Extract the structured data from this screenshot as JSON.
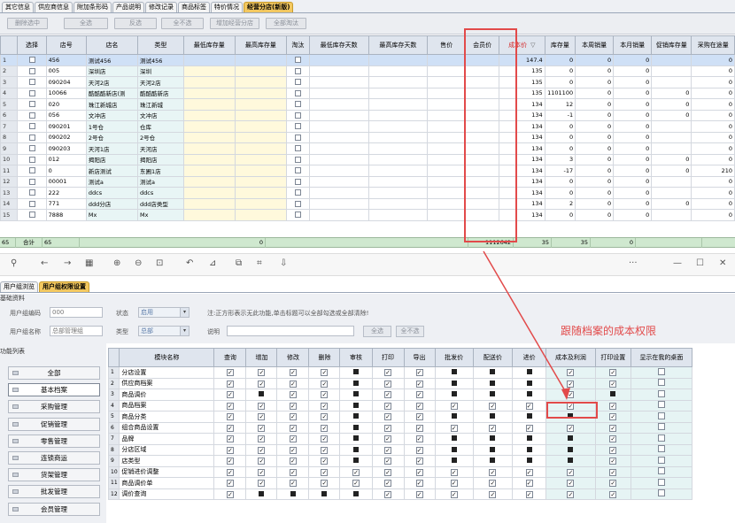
{
  "top_tabs": [
    "其它信息",
    "供应商信息",
    "附加条形码",
    "产品说明",
    "修改记录",
    "商品标签",
    "特价情况",
    "经营分店(新版)"
  ],
  "top_active_tab": 7,
  "toolbar1": [
    "删除选中",
    "全选",
    "反选",
    "全不选",
    "增加经营分店",
    "全部淘汰"
  ],
  "grid1": {
    "headers": [
      "",
      "选择",
      "店号",
      "店名",
      "类型",
      "最低库存量",
      "最高库存量",
      "淘汰",
      "最低库存天数",
      "最高库存天数",
      "售价",
      "会员价",
      "成本价",
      "库存量",
      "本周销量",
      "本月销量",
      "促销库存量",
      "采购在途量"
    ],
    "sort_icon": "▽",
    "rows": [
      [
        "1",
        "",
        "456",
        "测试456",
        "测试456",
        "",
        "",
        "",
        "",
        "",
        "",
        "",
        "147.4",
        "0",
        "0",
        "0",
        "",
        "0"
      ],
      [
        "2",
        "",
        "005",
        "深圳店",
        "深圳",
        "",
        "",
        "",
        "",
        "",
        "",
        "",
        "135",
        "0",
        "0",
        "0",
        "",
        "0"
      ],
      [
        "3",
        "",
        "090204",
        "天河2店",
        "天河2店",
        "",
        "",
        "",
        "",
        "",
        "",
        "",
        "135",
        "0",
        "0",
        "0",
        "",
        "0"
      ],
      [
        "4",
        "",
        "10066",
        "酷酷酷新店(测",
        "酷酷酷新店",
        "",
        "",
        "",
        "",
        "",
        "",
        "",
        "135",
        "1101100",
        "0",
        "0",
        "0",
        "0"
      ],
      [
        "5",
        "",
        "020",
        "珠江新城店",
        "珠江新城",
        "",
        "",
        "",
        "",
        "",
        "",
        "",
        "134",
        "12",
        "0",
        "0",
        "0",
        "0"
      ],
      [
        "6",
        "",
        "056",
        "文冲店",
        "文冲店",
        "",
        "",
        "",
        "",
        "",
        "",
        "",
        "134",
        "-1",
        "0",
        "0",
        "0",
        "0"
      ],
      [
        "7",
        "",
        "090201",
        "1号仓",
        "仓库",
        "",
        "",
        "",
        "",
        "",
        "",
        "",
        "134",
        "0",
        "0",
        "0",
        "",
        "0"
      ],
      [
        "8",
        "",
        "090202",
        "2号仓",
        "2号仓",
        "",
        "",
        "",
        "",
        "",
        "",
        "",
        "134",
        "0",
        "0",
        "0",
        "",
        "0"
      ],
      [
        "9",
        "",
        "090203",
        "天河1店",
        "天河店",
        "",
        "",
        "",
        "",
        "",
        "",
        "",
        "134",
        "0",
        "0",
        "0",
        "",
        "0"
      ],
      [
        "10",
        "",
        "012",
        "揭阳店",
        "揭阳店",
        "",
        "",
        "",
        "",
        "",
        "",
        "",
        "134",
        "3",
        "0",
        "0",
        "0",
        "0"
      ],
      [
        "11",
        "",
        "0",
        "新店测试",
        "东圃1店",
        "",
        "",
        "",
        "",
        "",
        "",
        "",
        "134",
        "-17",
        "0",
        "0",
        "0",
        "210"
      ],
      [
        "12",
        "",
        "00001",
        "测试a",
        "测试a",
        "",
        "",
        "",
        "",
        "",
        "",
        "",
        "134",
        "0",
        "0",
        "0",
        "",
        "0"
      ],
      [
        "13",
        "",
        "222",
        "ddcs",
        "ddcs",
        "",
        "",
        "",
        "",
        "",
        "",
        "",
        "134",
        "0",
        "0",
        "0",
        "",
        "0"
      ],
      [
        "14",
        "",
        "771",
        "ddd分店",
        "ddd店类型",
        "",
        "",
        "",
        "",
        "",
        "",
        "",
        "134",
        "2",
        "0",
        "0",
        "0",
        "0"
      ],
      [
        "15",
        "",
        "7888",
        "Mx",
        "Mx",
        "",
        "",
        "",
        "",
        "",
        "",
        "",
        "134",
        "0",
        "0",
        "0",
        "",
        "0"
      ]
    ],
    "summary": {
      "count": "65",
      "label": "合计",
      "store": "65",
      "min_stock": "0",
      "stock": "1112642",
      "week": "35",
      "month": "35",
      "promo": "0"
    }
  },
  "viewer_icons": [
    "pin-icon",
    "back-icon",
    "forward-icon",
    "grid-icon",
    "zoom-in-icon",
    "zoom-out-icon",
    "fit-icon",
    "rotate-icon",
    "edit-icon",
    "copy-icon",
    "crop-icon",
    "export-icon",
    "more-icon",
    "minimize-icon",
    "maximize-icon",
    "close-icon"
  ],
  "viewer_glyphs": [
    "⚲",
    "←",
    "→",
    "▦",
    "⊕",
    "⊖",
    "⊡",
    "↶",
    "⊿",
    "⧉",
    "⌗",
    "⇩",
    "···",
    "—",
    "☐",
    "✕"
  ],
  "bottom_tabs": [
    "用户组浏览",
    "用户组权限设置"
  ],
  "bottom_active_tab": 1,
  "basic": {
    "section_title": "基础资料",
    "code_label": "用户组编码",
    "code_value": "000",
    "name_label": "用户组名称",
    "name_value": "总部管理组",
    "status_label": "状态",
    "status_value": "启用",
    "type_label": "类型",
    "type_value": "总部",
    "hint": "注:正方形表示无此功能,单击标题可以全部勾选或全部清除!",
    "desc_label": "说明",
    "desc_value": "",
    "select_all": "全选",
    "select_none": "全不选"
  },
  "func_title": "功能列表",
  "func_list": [
    "全部",
    "基本档案",
    "采购管理",
    "促销管理",
    "零售管理",
    "连锁商运",
    "货架管理",
    "批发管理",
    "会员管理"
  ],
  "func_active": 1,
  "annotation": "跟随档案的成本权限",
  "grid2": {
    "headers": [
      "",
      "模块名称",
      "查询",
      "增加",
      "修改",
      "删除",
      "审核",
      "打印",
      "导出",
      "批发价",
      "配送价",
      "进价",
      "成本及利润",
      "打印设置",
      "显示在我的桌面"
    ],
    "rows": [
      {
        "n": "1",
        "name": "分店设置",
        "cells": [
          "c",
          "c",
          "c",
          "c",
          "b",
          "c",
          "c",
          "b",
          "b",
          "b",
          "c",
          "c",
          "e"
        ]
      },
      {
        "n": "2",
        "name": "供应商档案",
        "cells": [
          "c",
          "c",
          "c",
          "c",
          "b",
          "c",
          "c",
          "b",
          "b",
          "b",
          "c",
          "c",
          "e"
        ]
      },
      {
        "n": "3",
        "name": "商品调价",
        "cells": [
          "c",
          "b",
          "c",
          "c",
          "b",
          "c",
          "c",
          "b",
          "b",
          "b",
          "c",
          "b",
          "e"
        ]
      },
      {
        "n": "4",
        "name": "商品档案",
        "cells": [
          "c",
          "c",
          "c",
          "c",
          "b",
          "c",
          "c",
          "c",
          "c",
          "c",
          "c",
          "c",
          "e"
        ]
      },
      {
        "n": "5",
        "name": "商品分类",
        "cells": [
          "c",
          "c",
          "c",
          "c",
          "b",
          "c",
          "c",
          "b",
          "b",
          "b",
          "b",
          "c",
          "e"
        ]
      },
      {
        "n": "6",
        "name": "组合商品设置",
        "cells": [
          "c",
          "c",
          "c",
          "c",
          "b",
          "c",
          "c",
          "c",
          "c",
          "c",
          "c",
          "c",
          "e"
        ]
      },
      {
        "n": "7",
        "name": "品牌",
        "cells": [
          "c",
          "c",
          "c",
          "c",
          "b",
          "c",
          "c",
          "b",
          "b",
          "b",
          "b",
          "c",
          "e"
        ]
      },
      {
        "n": "8",
        "name": "分店区域",
        "cells": [
          "c",
          "c",
          "c",
          "c",
          "b",
          "c",
          "c",
          "b",
          "b",
          "b",
          "b",
          "c",
          "e"
        ]
      },
      {
        "n": "9",
        "name": "店类型",
        "cells": [
          "c",
          "c",
          "c",
          "c",
          "b",
          "c",
          "c",
          "b",
          "b",
          "b",
          "b",
          "c",
          "e"
        ]
      },
      {
        "n": "10",
        "name": "促销进价调整",
        "cells": [
          "c",
          "c",
          "c",
          "c",
          "c",
          "c",
          "c",
          "c",
          "c",
          "c",
          "c",
          "c",
          "e"
        ]
      },
      {
        "n": "11",
        "name": "商品调价单",
        "cells": [
          "c",
          "c",
          "c",
          "c",
          "c",
          "c",
          "c",
          "c",
          "c",
          "c",
          "c",
          "c",
          "e"
        ]
      },
      {
        "n": "12",
        "name": "调价查询",
        "cells": [
          "c",
          "b",
          "b",
          "b",
          "b",
          "c",
          "c",
          "c",
          "c",
          "c",
          "c",
          "c",
          "e"
        ]
      }
    ]
  }
}
